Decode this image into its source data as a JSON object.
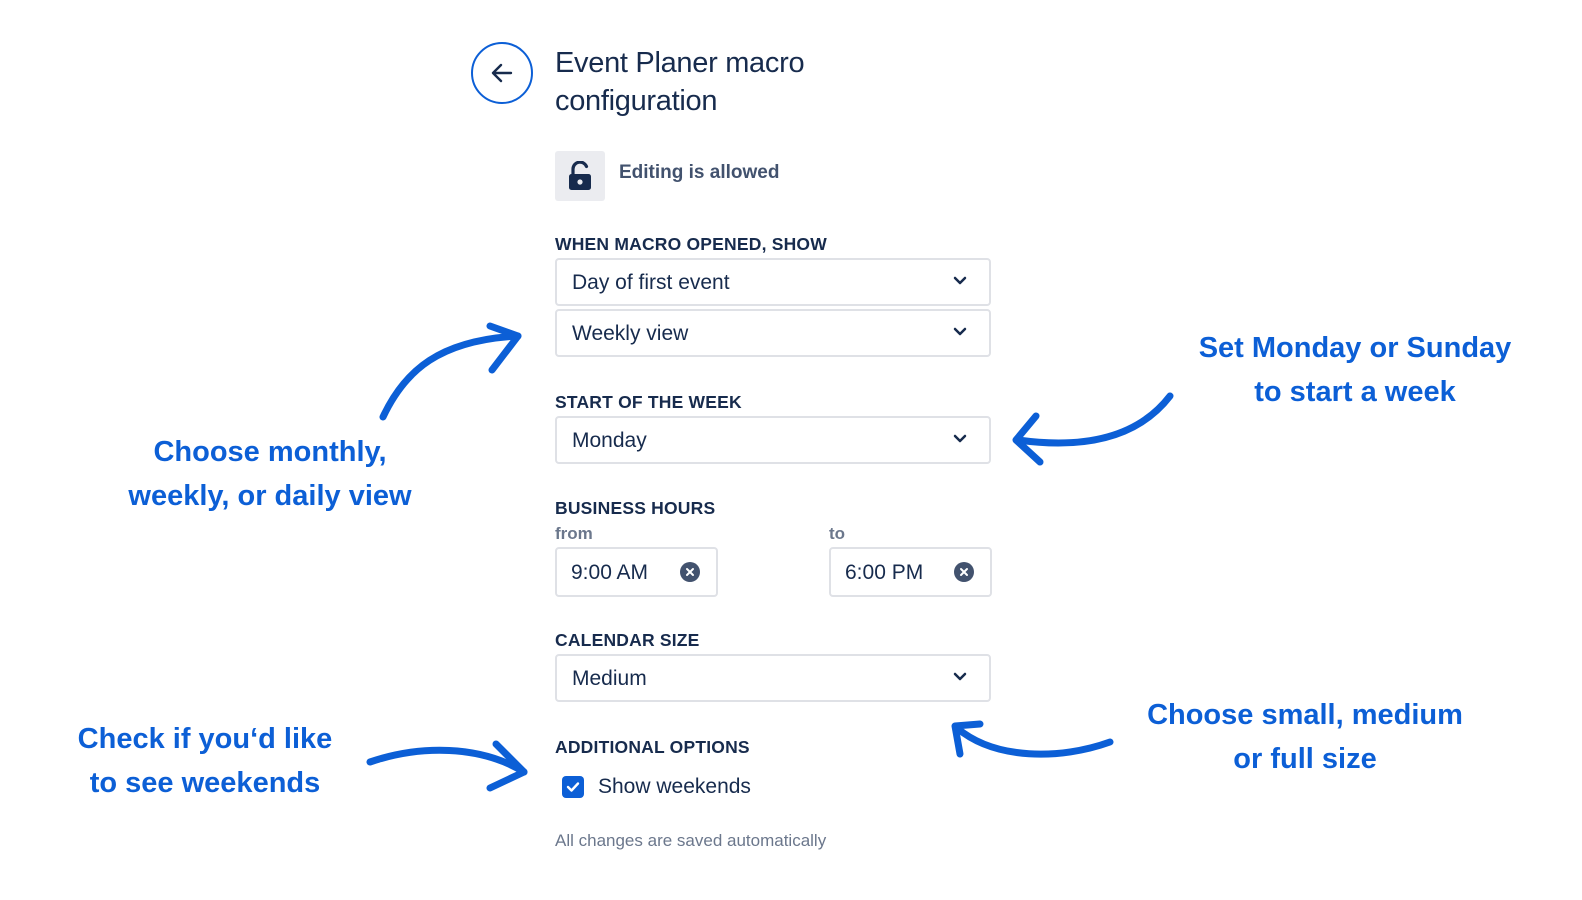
{
  "header": {
    "title": "Event Planer macro configuration"
  },
  "permission": {
    "text": "Editing is allowed",
    "icon": "unlock-icon"
  },
  "when_opened": {
    "label": "WHEN MACRO OPENED, SHOW",
    "day_value": "Day of first event",
    "view_value": "Weekly view"
  },
  "start_week": {
    "label": "START OF THE WEEK",
    "value": "Monday"
  },
  "business_hours": {
    "label": "BUSINESS HOURS",
    "from_label": "from",
    "from_value": "9:00 AM",
    "to_label": "to",
    "to_value": "6:00 PM"
  },
  "calendar_size": {
    "label": "CALENDAR SIZE",
    "value": "Medium"
  },
  "additional": {
    "label": "ADDITIONAL OPTIONS",
    "show_weekends_label": "Show weekends",
    "show_weekends_checked": true
  },
  "footer": {
    "autosave_text": "All changes are saved automatically"
  },
  "annotations": {
    "view_line1": "Choose monthly,",
    "view_line2": "weekly, or daily view",
    "week_line1": "Set Monday or Sunday",
    "week_line2": "to start a week",
    "weekend_line1": "Check if you‘d like",
    "weekend_line2": "to see weekends",
    "size_line1": "Choose small, medium",
    "size_line2": "or full size"
  },
  "colors": {
    "accent": "#0c5fd6",
    "text": "#172b4d",
    "muted": "#6b778c",
    "border": "#dfe1e6"
  }
}
